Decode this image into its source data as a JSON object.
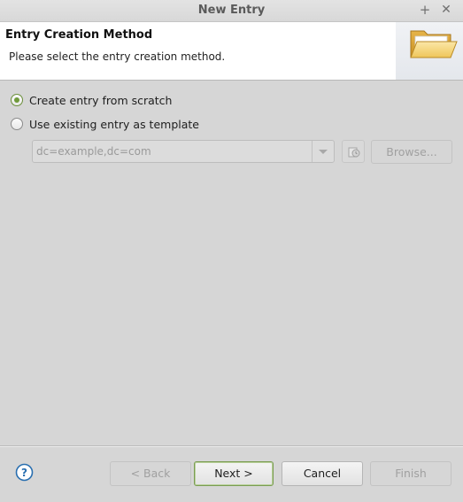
{
  "window": {
    "title": "New Entry",
    "plus_symbol": "+",
    "close_symbol": "✕"
  },
  "banner": {
    "title": "Entry Creation Method",
    "description": "Please select the entry creation method."
  },
  "options": {
    "scratch_label": "Create entry from scratch",
    "scratch_selected": true,
    "template_label": "Use existing entry as template",
    "template_selected": false
  },
  "template": {
    "dn_value": "dc=example,dc=com",
    "browse_label": "Browse..."
  },
  "footer": {
    "back_label": "< Back",
    "next_label": "Next >",
    "cancel_label": "Cancel",
    "finish_label": "Finish"
  },
  "colors": {
    "accent_green": "#6f9a3a",
    "help_blue": "#2a6fb0"
  }
}
